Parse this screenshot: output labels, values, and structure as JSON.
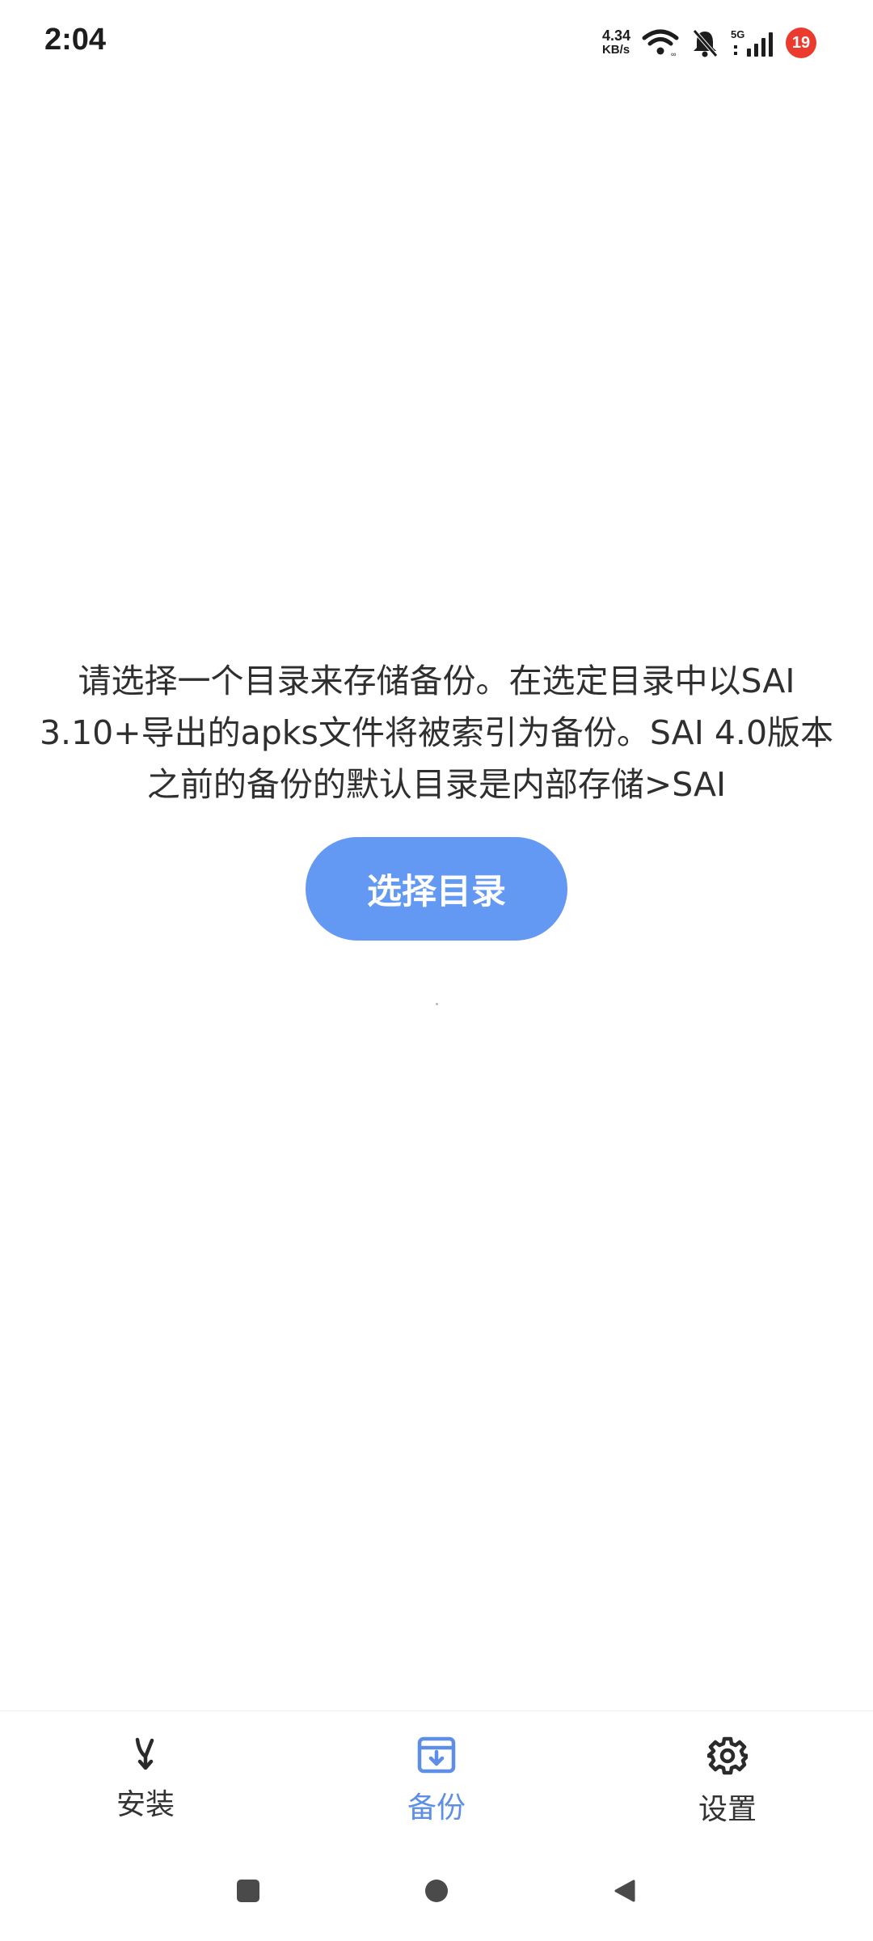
{
  "status_bar": {
    "time": "2:04",
    "net_speed_value": "4.34",
    "net_speed_unit": "KB/s",
    "network_type": "5G",
    "notification_count": "19",
    "icons": [
      "wifi-icon",
      "mute-bell-icon",
      "signal-icon"
    ]
  },
  "main": {
    "message_line1": "请选择一个目录来存储备份。在选定目录中以SAI",
    "message_line2": "3.10+导出的apks文件将被索引为备份。SAI 4.0版本",
    "message_line3": "之前的备份的默认目录是内部存储>SAI",
    "select_button_label": "选择目录"
  },
  "bottom_nav": {
    "items": [
      {
        "label": "安装",
        "icon": "install-merge-icon",
        "active": false
      },
      {
        "label": "备份",
        "icon": "backup-archive-icon",
        "active": true
      },
      {
        "label": "设置",
        "icon": "gear-icon",
        "active": false
      }
    ]
  },
  "colors": {
    "accent": "#6399f2",
    "active_nav": "#5d8fe6",
    "badge": "#ea3b2e",
    "text": "#2f2f2f"
  }
}
